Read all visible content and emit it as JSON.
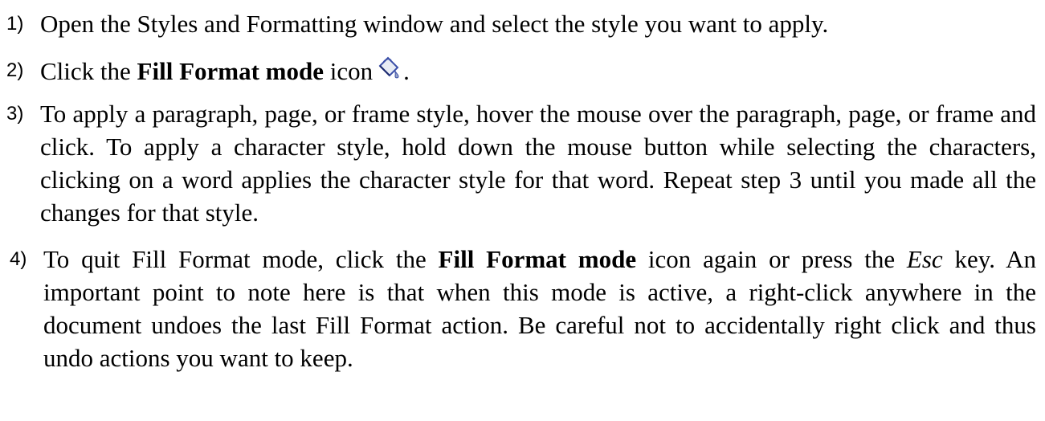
{
  "steps": [
    {
      "number": "1)",
      "text": "Open the Styles and Formatting window and select the style you want to apply."
    },
    {
      "number": "2)",
      "before": "Click the ",
      "bold": "Fill Format mode",
      "after": " icon",
      "icon": "paint-bucket-icon",
      "end": "."
    },
    {
      "number": "3)",
      "text": "To apply a paragraph, page, or frame style, hover the mouse over the paragraph, page, or frame and click. To apply a character style, hold down the mouse button while selecting the characters, clicking on a word applies the character style for that word. Repeat step 3 until you made all the changes for that style."
    },
    {
      "number": "4)",
      "before": "To quit Fill Format mode, click the ",
      "bold": "Fill Format mode",
      "middle": " icon again or press the ",
      "italic": "Esc",
      "after": " key. An important point to note here is that when this mode is active, a right-click anywhere in the document undoes the last Fill Format action. Be careful not to accidentally right click and thus undo actions you want to keep."
    }
  ]
}
